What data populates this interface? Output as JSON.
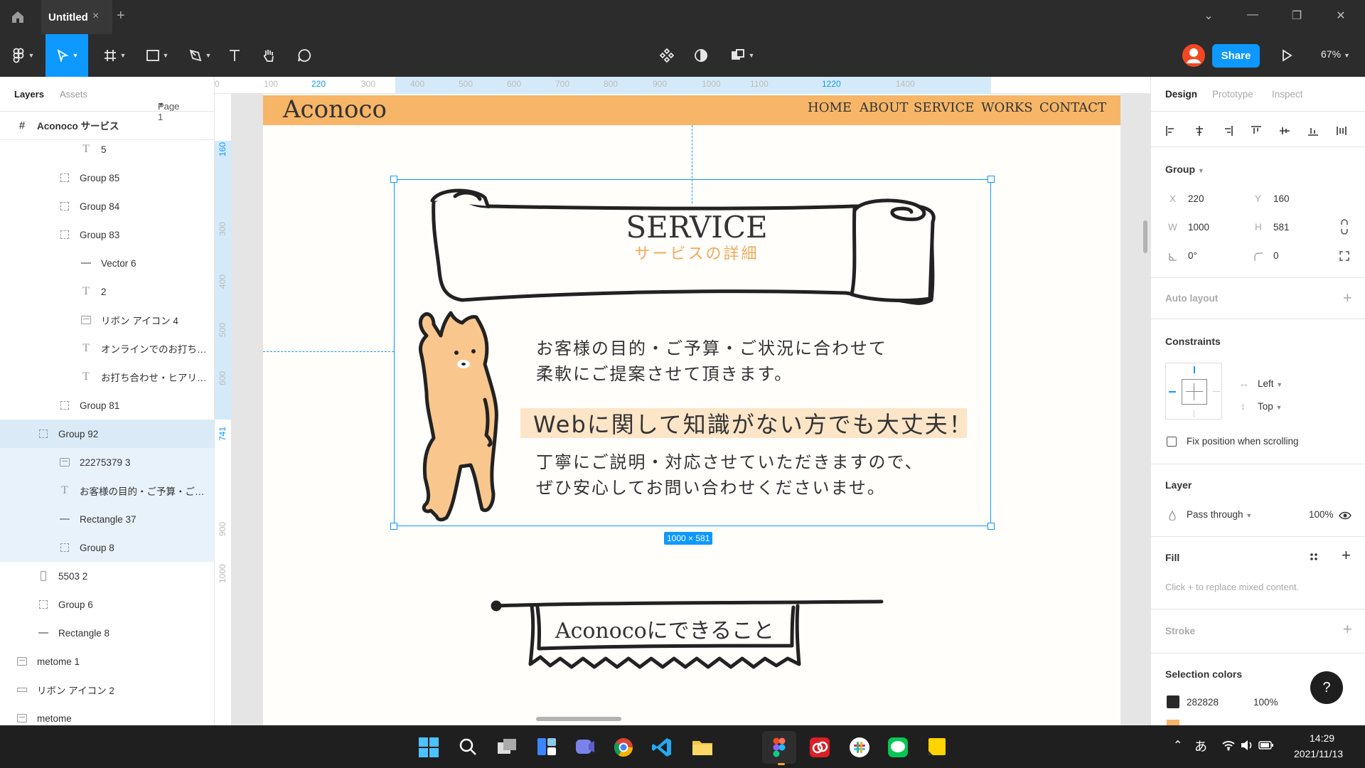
{
  "window": {
    "tab_title": "Untitled",
    "close_glyph": "×",
    "add_glyph": "+",
    "window_controls": [
      "⌄",
      "—",
      "❐",
      "✕"
    ]
  },
  "toolbar": {
    "share_label": "Share",
    "zoom_label": "67%",
    "selected_tool": "move"
  },
  "left_panel": {
    "tabs": [
      "Layers",
      "Assets"
    ],
    "page_label": "Page 1",
    "frame_name": "Aconoco サービス",
    "layers": [
      {
        "name": "5",
        "icon": "text"
      },
      {
        "name": "Group 85",
        "icon": "group"
      },
      {
        "name": "Group 84",
        "icon": "group"
      },
      {
        "name": "Group 83",
        "icon": "group"
      },
      {
        "name": "Vector 6",
        "icon": "line"
      },
      {
        "name": "2",
        "icon": "text"
      },
      {
        "name": "リボン アイコン 4",
        "icon": "image"
      },
      {
        "name": "オンラインでのお打ち…",
        "icon": "text"
      },
      {
        "name": "お打ち合わせ・ヒアリ…",
        "icon": "text"
      },
      {
        "name": "Group 81",
        "icon": "group"
      },
      {
        "name": "Group 92",
        "icon": "group"
      },
      {
        "name": "22275379 3",
        "icon": "image"
      },
      {
        "name": "お客様の目的・ご予算・ご…",
        "icon": "text"
      },
      {
        "name": "Rectangle 37",
        "icon": "line"
      },
      {
        "name": "Group 8",
        "icon": "group"
      },
      {
        "name": "5503 2",
        "icon": "rect"
      },
      {
        "name": "Group 6",
        "icon": "group"
      },
      {
        "name": "Rectangle 8",
        "icon": "line"
      },
      {
        "name": "metome 1",
        "icon": "image"
      },
      {
        "name": "リボン アイコン 2",
        "icon": "rect2"
      },
      {
        "name": "metome",
        "icon": "image"
      }
    ]
  },
  "rulers": {
    "h_ticks": [
      "0",
      "100",
      "220",
      "300",
      "400",
      "500",
      "600",
      "700",
      "800",
      "900",
      "1000",
      "1100",
      "1220",
      "1400"
    ],
    "v_ticks": [
      "160",
      "300",
      "400",
      "500",
      "600",
      "741",
      "900",
      "1000"
    ]
  },
  "canvas": {
    "logo": "Aconoco",
    "nav": [
      "HOME",
      "ABOUT",
      "SERVICE",
      "WORKS",
      "CONTACT"
    ],
    "service_title": "SERVICE",
    "service_subtitle": "サービスの詳細",
    "body_line1": "お客様の目的・ご予算・ご状況に合わせて",
    "body_line2": "柔軟にご提案させて頂きます。",
    "highlight": "Webに関して知識がない方でも大丈夫！",
    "body_line3": "丁寧にご説明・対応させていただきますので、",
    "body_line4": "ぜひ安心してお問い合わせくださいませ。",
    "size_badge": "1000 × 581",
    "banner2": "Aconocoにできること"
  },
  "right_panel": {
    "tabs": [
      "Design",
      "Prototype",
      "Inspect"
    ],
    "group_label": "Group",
    "x_label": "X",
    "x": "220",
    "y_label": "Y",
    "y": "160",
    "w_label": "W",
    "w": "1000",
    "h_label": "H",
    "h": "581",
    "rotation": "0°",
    "radius": "0",
    "auto_layout": "Auto layout",
    "constraints": "Constraints",
    "constraint_h": "Left",
    "constraint_v": "Top",
    "fix_position": "Fix position when scrolling",
    "layer": "Layer",
    "blend": "Pass through",
    "opacity": "100%",
    "fill": "Fill",
    "fill_hint": "Click + to replace mixed content.",
    "stroke": "Stroke",
    "selection_colors": "Selection colors",
    "color_hex": "282828",
    "color_opacity": "100%",
    "help": "?"
  },
  "taskbar": {
    "time": "14:29",
    "date": "2021/11/13",
    "ime": "あ"
  },
  "colors": {
    "accent": "#0d99ff",
    "header_orange": "#f6b567",
    "subtitle_orange": "#f0a95a",
    "highlight_bg": "#fde5c8",
    "swatch": "#282828"
  }
}
